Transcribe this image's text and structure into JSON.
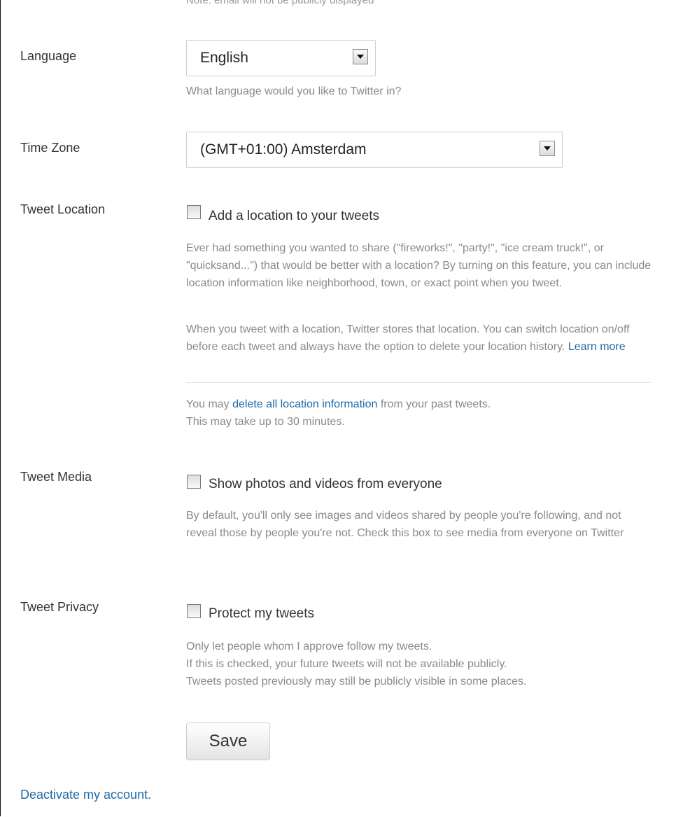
{
  "top_note": "Note: email will not be publicly displayed",
  "language": {
    "label": "Language",
    "selected": "English",
    "help": "What language would you like to Twitter in?"
  },
  "timezone": {
    "label": "Time Zone",
    "selected": "(GMT+01:00) Amsterdam"
  },
  "tweet_location": {
    "label": "Tweet Location",
    "checkbox_label": "Add a location to your tweets",
    "checked": false,
    "help1": "Ever had something you wanted to share (\"fireworks!\", \"party!\", \"ice cream truck!\", or \"quicksand...\") that would be better with a location? By turning on this feature, you can include location information like neighborhood, town, or exact point when you tweet.",
    "help2": "When you tweet with a location, Twitter stores that location. You can switch location on/off before each tweet and always have the option to delete your location history.",
    "learn_more": "Learn more",
    "delete_prefix": "You may",
    "delete_link": "delete all location information",
    "delete_suffix": "from your past tweets.",
    "delete_note": "This may take up to 30 minutes."
  },
  "tweet_media": {
    "label": "Tweet Media",
    "checkbox_label": "Show photos and videos from everyone",
    "checked": false,
    "help": "By default, you'll only see images and videos shared by people you're following, and not reveal those by people you're not. Check this box to see media from everyone on Twitter"
  },
  "tweet_privacy": {
    "label": "Tweet Privacy",
    "checkbox_label": "Protect my tweets",
    "checked": false,
    "help_lines": [
      "Only let people whom I approve follow my tweets.",
      "If this is checked, your future tweets will not be available publicly.",
      "Tweets posted previously may still be publicly visible in some places."
    ]
  },
  "save_label": "Save",
  "deactivate_label": "Deactivate my account.",
  "colors": {
    "link": "#1f6aa5",
    "help_text": "#8a8a8a",
    "label_text": "#333333"
  }
}
